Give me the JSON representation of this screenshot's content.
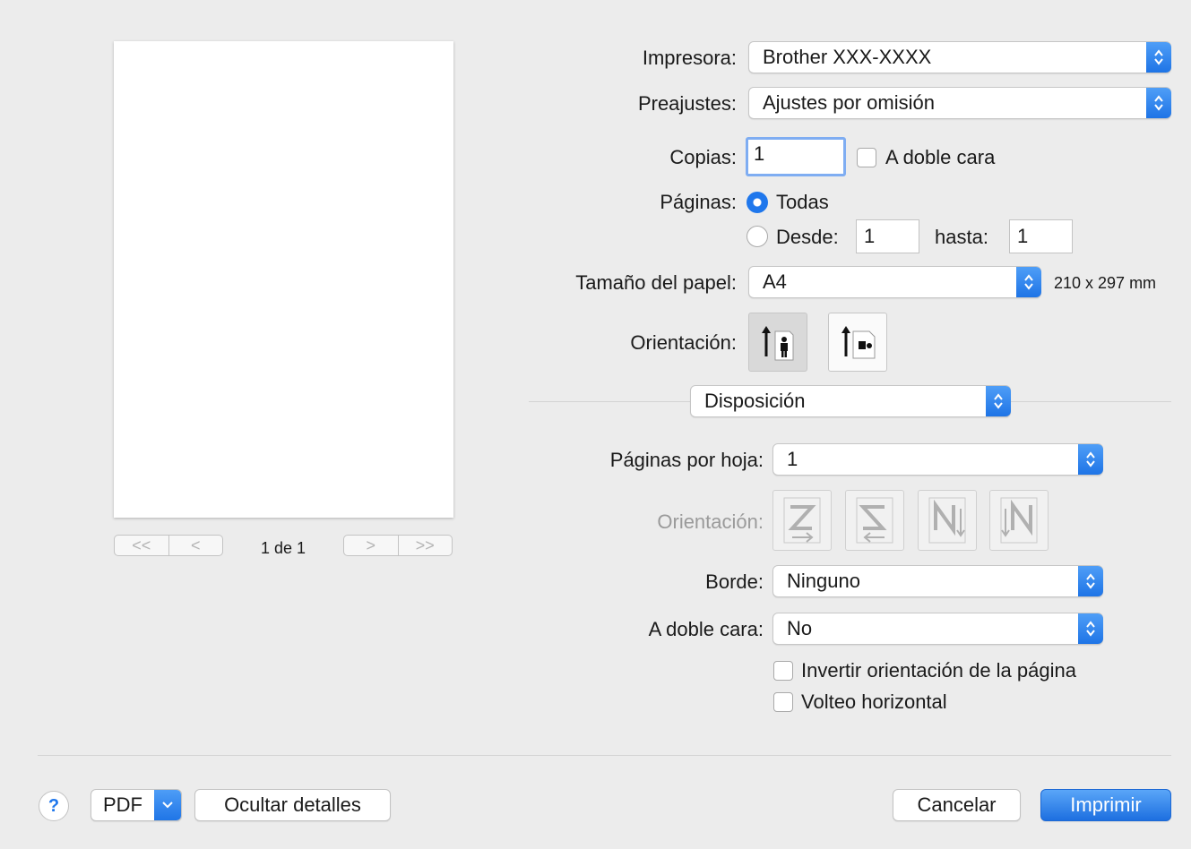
{
  "preview": {
    "page_indicator": "1 de 1",
    "nav_first": "<<",
    "nav_prev": "<",
    "nav_next": ">",
    "nav_last": ">>"
  },
  "printer": {
    "label": "Impresora:",
    "value": "Brother XXX-XXXX"
  },
  "presets": {
    "label": "Preajustes:",
    "value": "Ajustes por omisión"
  },
  "copies": {
    "label": "Copias:",
    "value": "1",
    "duplex_label": "A doble cara",
    "duplex_checked": false
  },
  "pages": {
    "label": "Páginas:",
    "all_label": "Todas",
    "all_selected": true,
    "from_label": "Desde:",
    "from_value": "1",
    "to_label": "hasta:",
    "to_value": "1"
  },
  "paper_size": {
    "label": "Tamaño del papel:",
    "value": "A4",
    "dimensions": "210 x 297 mm"
  },
  "orientation": {
    "label": "Orientación:",
    "options": [
      "portrait-icon",
      "landscape-icon"
    ],
    "selected": "portrait"
  },
  "section": {
    "value": "Disposición"
  },
  "layout": {
    "pages_per_sheet_label": "Páginas por hoja:",
    "pages_per_sheet_value": "1",
    "direction_label": "Orientación:",
    "direction_enabled": false,
    "directions": [
      "z-order-icon",
      "reverse-z-order-icon",
      "n-order-icon",
      "reverse-n-order-icon"
    ],
    "border_label": "Borde:",
    "border_value": "Ninguno",
    "two_sided_label": "A doble cara:",
    "two_sided_value": "No",
    "reverse_label": "Invertir orientación de la página",
    "reverse_checked": false,
    "flip_label": "Volteo horizontal",
    "flip_checked": false
  },
  "footer": {
    "help": "?",
    "pdf": "PDF",
    "hide_details": "Ocultar detalles",
    "cancel": "Cancelar",
    "print": "Imprimir"
  },
  "colors": {
    "accent": "#1f77ec",
    "background": "#ececec"
  }
}
